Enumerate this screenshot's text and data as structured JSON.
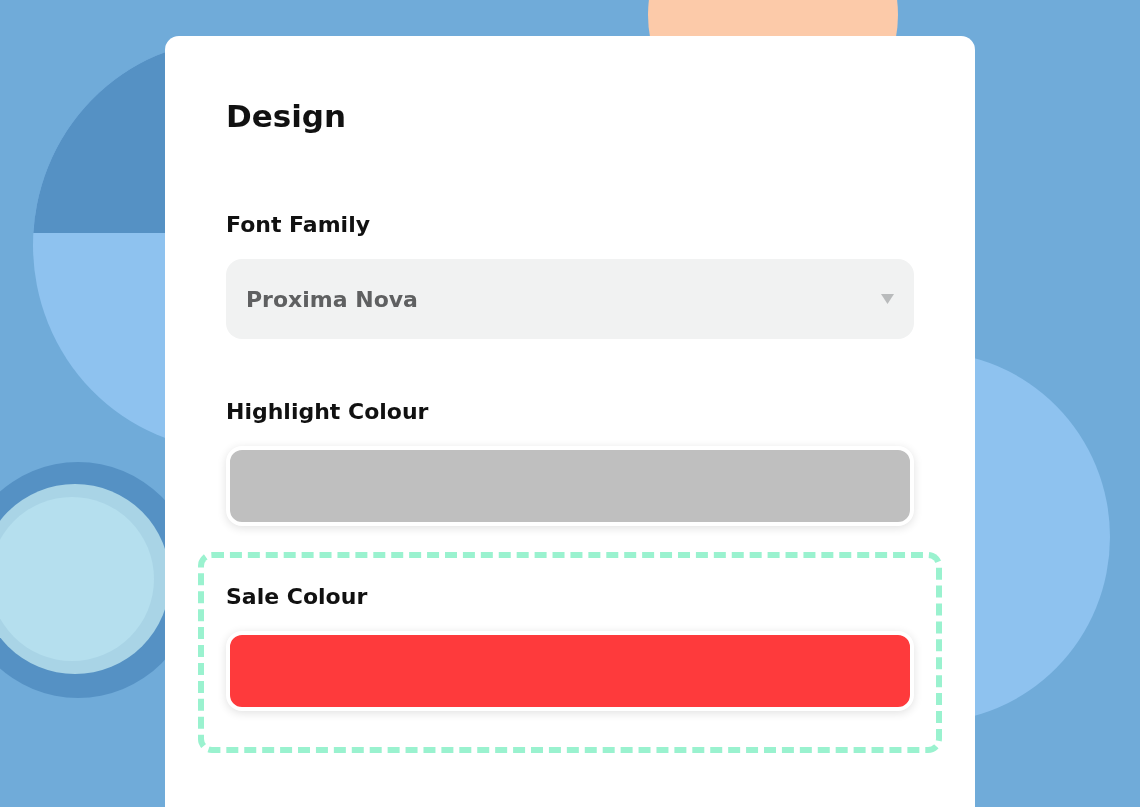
{
  "panel": {
    "title": "Design"
  },
  "fields": [
    {
      "kind": "select",
      "label": "Font Family",
      "value": "Proxima Nova",
      "highlighted": false
    },
    {
      "kind": "color",
      "label": "Highlight Colour",
      "color": "#bfbfbf",
      "highlighted": false
    },
    {
      "kind": "color",
      "label": "Sale Colour",
      "color": "#fe3a3c",
      "highlighted": true
    }
  ]
}
